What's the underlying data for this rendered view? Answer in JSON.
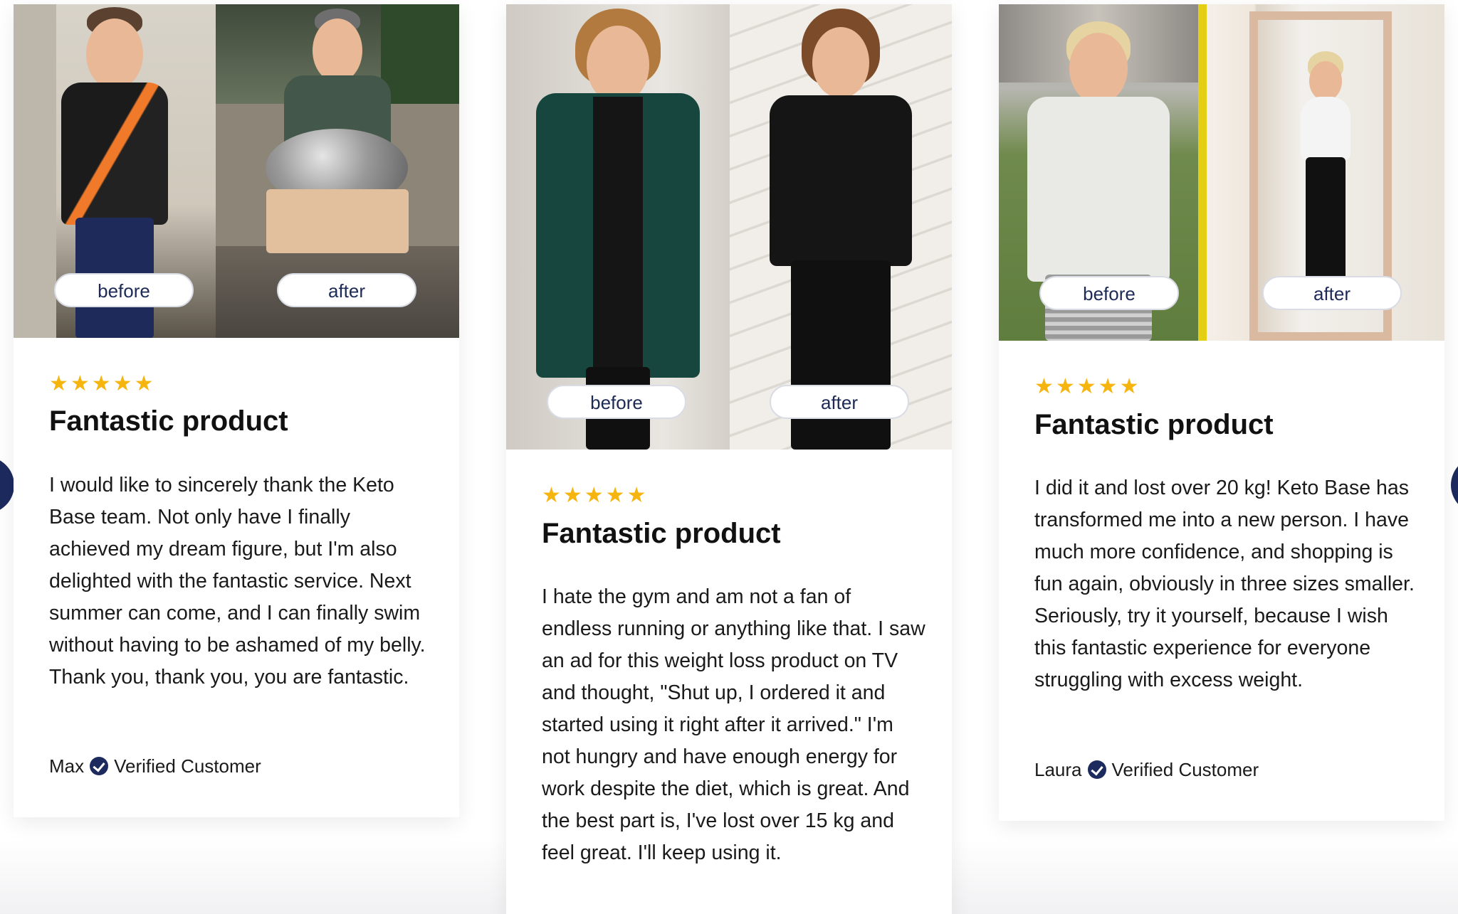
{
  "colors": {
    "accent": "#1c2a5e",
    "star": "#f6b40e",
    "pill_text": "#1c2a55"
  },
  "reviews": [
    {
      "before_label": "before",
      "after_label": "after",
      "stars": "★★★★★",
      "rating": 5,
      "title": "Fantastic product",
      "text": "I would like to sincerely thank the Keto Base team. Not only have I finally achieved my dream figure, but I'm also delighted with the fantastic service. Next summer can come, and I can finally swim without having to be ashamed of my belly. Thank you, thank you, you are fantastic.",
      "author": "Max",
      "verified_label": "Verified Customer"
    },
    {
      "before_label": "before",
      "after_label": "after",
      "stars": "★★★★★",
      "rating": 5,
      "title": "Fantastic product",
      "text": "I hate the gym and am not a fan of endless running or anything like that. I saw an ad for this weight loss product on TV and thought, \"Shut up, I ordered it and started using it right after it arrived.\" I'm not hungry and have enough energy for work despite the diet, which is great. And the best part is, I've lost over 15 kg and feel great. I'll keep using it.",
      "author": "",
      "verified_label": ""
    },
    {
      "before_label": "before",
      "after_label": "after",
      "stars": "★★★★★",
      "rating": 5,
      "title": "Fantastic product",
      "text": "I did it and lost over 20 kg! Keto Base has transformed me into a new person. I have much more confidence, and shopping is fun again, obviously in three sizes smaller. Seriously, try it yourself, because I wish this fantastic experience for everyone struggling with excess weight.",
      "author": "Laura",
      "verified_label": "Verified Customer"
    }
  ]
}
